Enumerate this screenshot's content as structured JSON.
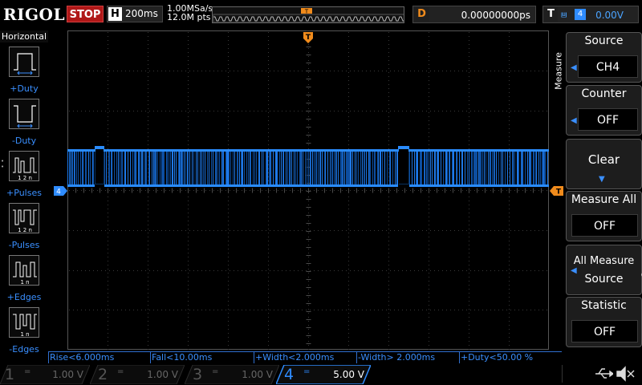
{
  "topbar": {
    "logo": "RIGOL",
    "run_state": "STOP",
    "timebase_letter": "H",
    "timebase_value": "200ms",
    "sample_rate": "1.00MSa/s",
    "memory_depth": "12.0M pts",
    "delay_letter": "D",
    "delay_value": "0.00000000ps",
    "trigger_letter": "T",
    "trigger_source": "4",
    "trigger_level": "0.00V",
    "trigger_marker": "T"
  },
  "left_panel": {
    "title": "Horizontal",
    "items": [
      {
        "label": "+Duty",
        "icon": "pos-duty-icon"
      },
      {
        "label": "-Duty",
        "icon": "neg-duty-icon"
      },
      {
        "label": "+Pulses",
        "icon": "pos-pulses-icon"
      },
      {
        "label": "-Pulses",
        "icon": "neg-pulses-icon"
      },
      {
        "label": "+Edges",
        "icon": "pos-edges-icon"
      },
      {
        "label": "-Edges",
        "icon": "neg-edges-icon"
      }
    ],
    "icon_subtexts": {
      "pulses": "1 2 n",
      "edges": "1 n"
    }
  },
  "screen": {
    "channel_marker": "4",
    "trigger_level_marker": "T",
    "trace_color": "#1e78e6"
  },
  "right_panel": {
    "menu_title": "Measure",
    "buttons": [
      {
        "title": "Source",
        "value": "CH4",
        "has_arrow": true
      },
      {
        "title": "Counter",
        "value": "OFF",
        "has_arrow": true
      },
      {
        "title": "Clear",
        "value": "",
        "has_arrow": false
      },
      {
        "title": "Measure All",
        "value": "OFF",
        "has_arrow": false
      },
      {
        "title": "All Measure",
        "value": "Source",
        "has_arrow": true
      },
      {
        "title": "Statistic",
        "value": "OFF",
        "has_arrow": false
      }
    ]
  },
  "measurements": [
    "Rise<6.000ms",
    "Fall<10.00ms",
    "+Width<2.000ms",
    "-Width> 2.000ms",
    "+Duty<50.00 %"
  ],
  "channels": [
    {
      "num": "1",
      "value": "1.00 V",
      "coupling": "=",
      "active": false
    },
    {
      "num": "2",
      "value": "1.00 V",
      "coupling": "=",
      "active": false
    },
    {
      "num": "3",
      "value": "1.00 V",
      "coupling": "=",
      "active": false
    },
    {
      "num": "4",
      "value": "5.00 V",
      "coupling": "=",
      "active": true
    }
  ],
  "status_icons": [
    "usb-icon",
    "speaker-muted-icon"
  ]
}
